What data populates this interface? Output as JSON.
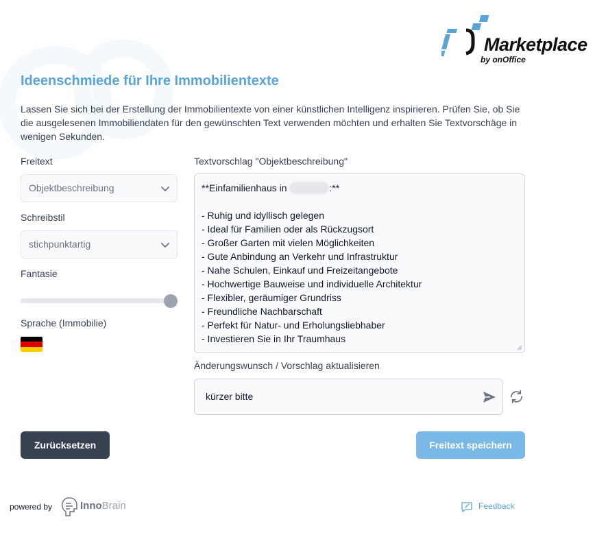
{
  "header": {
    "logo_title": "Marketplace",
    "logo_subtitle": "by onOffice",
    "title": "Ideenschmiede für Ihre Immobilientexte",
    "intro": "Lassen Sie sich bei der Erstellung der Immobilientexte von einer künstlichen Intelligenz inspirieren. Prüfen Sie, ob Sie die ausgelesenen Immobiliendaten für den gewünschten Text verwenden möchten und erhalten Sie Textvorschäge in wenigen Sekunden."
  },
  "form": {
    "freitext_label": "Freitext",
    "freitext_value": "Objektbeschreibung",
    "schreibstil_label": "Schreibstil",
    "schreibstil_value": "stichpunktartig",
    "fantasie_label": "Fantasie",
    "fantasie_level": 1.0,
    "sprache_label": "Sprache (Immobilie)",
    "sprache_flag": "de-flag-icon"
  },
  "suggestion": {
    "label": "Textvorschlag \"Objektbeschreibung\"",
    "heading_prefix": "**Einfamilienhaus in ",
    "heading_suffix": ":**",
    "lines": [
      "- Ruhig und idyllisch gelegen",
      "- Ideal für Familien oder als Rückzugsort",
      "- Großer Garten mit vielen Möglichkeiten",
      "- Gute Anbindung an Verkehr und Infrastruktur",
      "- Nahe Schulen, Einkauf und Freizeitangebote",
      "- Hochwertige Bauweise und individuelle Architektur",
      "- Flexibler, geräumiger Grundriss",
      "- Freundliche Nachbarschaft",
      "- Perfekt für Natur- und Erholungsliebhaber",
      "- Investieren Sie in Ihr Traumhaus"
    ]
  },
  "change_request": {
    "label": "Änderungswunsch / Vorschlag aktualisieren",
    "value": "kürzer bitte"
  },
  "buttons": {
    "reset": "Zurücksetzen",
    "save": "Freitext speichern"
  },
  "footer": {
    "powered_by": "powered by",
    "brand_bold": "Inno",
    "brand_light": "Brain",
    "feedback": "Feedback"
  },
  "colors": {
    "accent": "#5aa4d8",
    "save_button": "#7ab8e6",
    "reset_button": "#374151"
  }
}
